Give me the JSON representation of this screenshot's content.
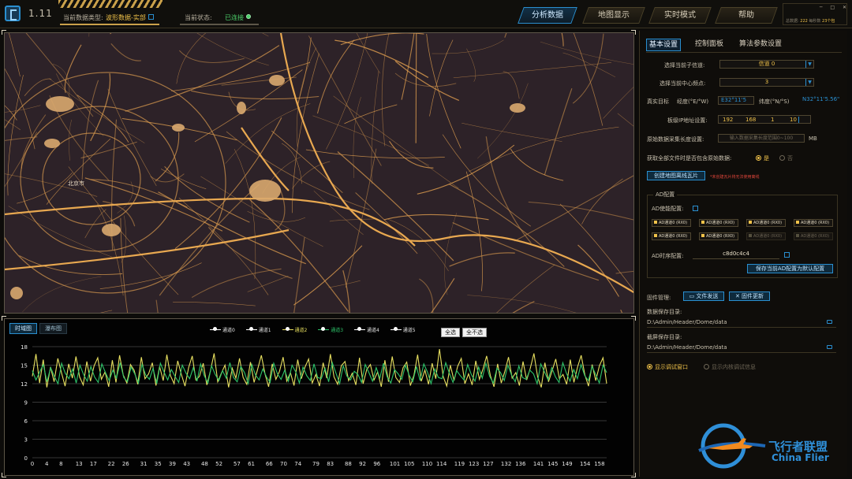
{
  "header": {
    "version": "1.11",
    "data_type_label": "当前数据类型:",
    "data_type_value": "波形数据-实部",
    "status_label": "当前状态:",
    "status_value": "已连接",
    "tabs": [
      {
        "label": "分析数据",
        "active": true
      },
      {
        "label": "地图显示",
        "active": false
      },
      {
        "label": "实时模式",
        "active": false
      },
      {
        "label": "帮助",
        "active": false
      }
    ],
    "corner_info": {
      "total_label": "总数据:",
      "total_value": "222",
      "rate_label": "每秒数",
      "rate_value": "23个包"
    },
    "window_controls": [
      "─",
      "□",
      "✕"
    ]
  },
  "map": {
    "city_label": "北京市",
    "road_color": "#d99a4e",
    "area_color": "#d9a86e",
    "bg_color": "#2d2228"
  },
  "chart_panel": {
    "tabs": [
      {
        "label": "时域图",
        "active": true
      },
      {
        "label": "瀑布图",
        "active": false
      }
    ],
    "select_all": "全选",
    "select_none": "全不选"
  },
  "chart_data": {
    "type": "line",
    "title": "",
    "xlabel": "",
    "ylabel": "",
    "ylim": [
      0,
      18
    ],
    "yticks": [
      0,
      3,
      6,
      9,
      12,
      15,
      18
    ],
    "xticks": [
      0,
      4,
      8,
      13,
      17,
      22,
      26,
      31,
      35,
      39,
      43,
      48,
      52,
      57,
      61,
      66,
      70,
      74,
      79,
      83,
      88,
      92,
      96,
      101,
      105,
      110,
      114,
      119,
      123,
      127,
      132,
      136,
      141,
      145,
      149,
      154,
      158
    ],
    "xlim": [
      0,
      160
    ],
    "grid": true,
    "series": [
      {
        "name": "通道0",
        "color": "#ffffff",
        "visible": false,
        "values": []
      },
      {
        "name": "通道1",
        "color": "#ffffff",
        "visible": false,
        "values": []
      },
      {
        "name": "通道2",
        "color": "#e8e060",
        "visible": true,
        "values": [
          13.2,
          16.8,
          12.1,
          15.9,
          11.4,
          14.7,
          12.3,
          16.1,
          13.8,
          11.6,
          15.2,
          12.9,
          16.4,
          13.1,
          11.8,
          15.6,
          12.4,
          14.9,
          16.2,
          12.7,
          13.9,
          11.5,
          15.8,
          12.2,
          16.6,
          13.4,
          12.1,
          15.1,
          14.2,
          11.9,
          16.3,
          12.8,
          13.6,
          15.4,
          11.7,
          14.8,
          12.5,
          16.7,
          13.3,
          12.0,
          15.7,
          13.5,
          11.6,
          14.6,
          16.5,
          12.6,
          13.2,
          15.3,
          11.8,
          14.1,
          16.9,
          12.3,
          13.7,
          15.0,
          11.4,
          14.5,
          12.9,
          16.1,
          13.0,
          11.9,
          15.5,
          12.2,
          14.4,
          16.6,
          13.6,
          11.5,
          15.2,
          12.7,
          14.0,
          16.3,
          12.4,
          13.8,
          11.7,
          15.9,
          12.8,
          14.7,
          16.0,
          12.1,
          13.5,
          11.6,
          15.4,
          12.9,
          16.8,
          13.1,
          11.9,
          14.9,
          15.6,
          12.5,
          13.7,
          11.8,
          16.2,
          12.0,
          14.3,
          15.1,
          12.6,
          13.9,
          11.5,
          15.8,
          12.3,
          16.4,
          13.0,
          12.2,
          14.6,
          15.5,
          11.7,
          13.4,
          16.7,
          12.4,
          14.2,
          11.9,
          15.3,
          12.8,
          17.6,
          13.2,
          11.6,
          15.0,
          12.5,
          14.8,
          16.1,
          12.0,
          13.6,
          11.8,
          15.7,
          12.7,
          14.4,
          16.5,
          13.3,
          11.5,
          15.2,
          12.1,
          14.0,
          16.3,
          12.9,
          13.8,
          11.7,
          15.6,
          12.6,
          14.5,
          16.9,
          13.1,
          11.4,
          15.4,
          12.3,
          14.1,
          16.0,
          12.8,
          13.5,
          11.9,
          15.9,
          12.2,
          14.7,
          16.6,
          13.4,
          11.6,
          15.1,
          12.5,
          14.9,
          16.2,
          12.0
        ]
      },
      {
        "name": "通道3",
        "color": "#2ec46a",
        "visible": true,
        "values": [
          14.1,
          12.6,
          13.9,
          15.1,
          12.3,
          14.6,
          13.2,
          12.0,
          15.3,
          13.7,
          12.8,
          14.4,
          12.1,
          15.0,
          13.5,
          12.4,
          14.8,
          13.1,
          12.2,
          15.2,
          13.8,
          12.5,
          14.2,
          12.9,
          15.4,
          13.0,
          12.3,
          14.7,
          13.6,
          12.1,
          15.1,
          13.4,
          12.7,
          14.5,
          12.0,
          15.3,
          13.9,
          12.6,
          14.3,
          13.2,
          12.2,
          15.0,
          13.7,
          12.8,
          14.6,
          12.4,
          15.2,
          13.3,
          12.1,
          14.9,
          13.5,
          12.5,
          14.1,
          12.9,
          15.4,
          13.0,
          12.3,
          14.8,
          13.8,
          12.0,
          15.1,
          13.4,
          12.6,
          14.4,
          13.1,
          12.2,
          15.3,
          13.6,
          12.7,
          14.2,
          12.4,
          15.0,
          13.9,
          12.1,
          14.7,
          13.3,
          12.5,
          15.2,
          13.0,
          12.8,
          14.5,
          12.3,
          15.4,
          13.7,
          12.0,
          14.9,
          13.2,
          12.6,
          14.0,
          13.5,
          12.2,
          15.1,
          13.8,
          12.4,
          14.6,
          12.9,
          15.3,
          13.1,
          12.1,
          14.3,
          13.6,
          12.7,
          15.0,
          13.4,
          12.3,
          14.8,
          12.5,
          15.2,
          13.9,
          12.0,
          14.4,
          13.0,
          12.8,
          15.4,
          13.7,
          12.2,
          14.1,
          13.3,
          12.6,
          15.1,
          13.5,
          12.4,
          14.7,
          12.9,
          15.3,
          13.2,
          12.1,
          14.5,
          13.8,
          12.5,
          15.0,
          13.4,
          12.3,
          14.9,
          13.0,
          12.7,
          14.2,
          13.6,
          12.0,
          15.2,
          13.9,
          12.6,
          14.6,
          13.1,
          12.2,
          15.4,
          13.7,
          12.4,
          14.3,
          12.8,
          15.1,
          13.3,
          12.5,
          14.8,
          13.5,
          12.1,
          15.0,
          13.8
        ]
      },
      {
        "name": "通道4",
        "color": "#ffffff",
        "visible": false,
        "values": []
      },
      {
        "name": "通道5",
        "color": "#ffffff",
        "visible": false,
        "values": []
      }
    ]
  },
  "right_panel": {
    "tabs": [
      {
        "label": "基本设置",
        "active": true
      },
      {
        "label": "控制面板",
        "active": false
      },
      {
        "label": "算法参数设置",
        "active": false
      }
    ],
    "subchannel_label": "选择当前子信道:",
    "subchannel_value": "信道 0",
    "center_freq_label": "选择当前中心频点:",
    "center_freq_value": "3",
    "target_label": "真实目标",
    "lon_label": "经度(°E/°W)",
    "lon_value": "E32°11'5",
    "lat_label": "纬度(°N/°S)",
    "lat_value": "N32°11'5.56\"",
    "ip_label": "板级IP地址设置:",
    "ip": [
      "192",
      "168",
      "1",
      "10"
    ],
    "length_label": "原始数据采集长度设置:",
    "length_placeholder": "输入数据采集长度范围0~100",
    "length_unit": "MB",
    "include_raw_label": "获取全部文件时是否包含原始数据:",
    "yes_label": "是",
    "no_label": "否",
    "create_btn": "创建地图离线瓦片",
    "create_hint": "*未创建瓦片将无法使用离线",
    "ad_title": "AD配置",
    "ad_enable_label": "AD使能配置:",
    "ad_buttons": [
      {
        "label": "AD通道0 (RX0)",
        "dim": false
      },
      {
        "label": "AD通道0 (RX0)",
        "dim": false
      },
      {
        "label": "AD通道0 (RX0)",
        "dim": false
      },
      {
        "label": "AD通道0 (RX0)",
        "dim": false
      },
      {
        "label": "AD通道0 (RX0)",
        "dim": false
      },
      {
        "label": "AD通道0 (RX0)",
        "dim": false
      },
      {
        "label": "AD通道0 (RX0)",
        "dim": true
      },
      {
        "label": "AD通道0 (RX0)",
        "dim": true
      }
    ],
    "ad_timing_label": "AD时序配置:",
    "ad_timing_value": "c8d0c4c4",
    "save_ad_btn": "保存当前AD配置为默认配置",
    "firmware_label": "固件管理:",
    "file_send_btn": "文件发送",
    "firmware_update_btn": "固件更新",
    "data_dir_label": "数据保存目录:",
    "data_dir_value": "D:\\Admin/Header/Dome/data",
    "shot_dir_label": "截屏保存目录:",
    "shot_dir_value": "D:\\Admin/Header/Dome/data",
    "show_debug_label": "显示调试窗口",
    "show_internal_label": "显示内核调试信息"
  },
  "watermark": {
    "cn": "飞行者联盟",
    "en": "China Flier"
  }
}
